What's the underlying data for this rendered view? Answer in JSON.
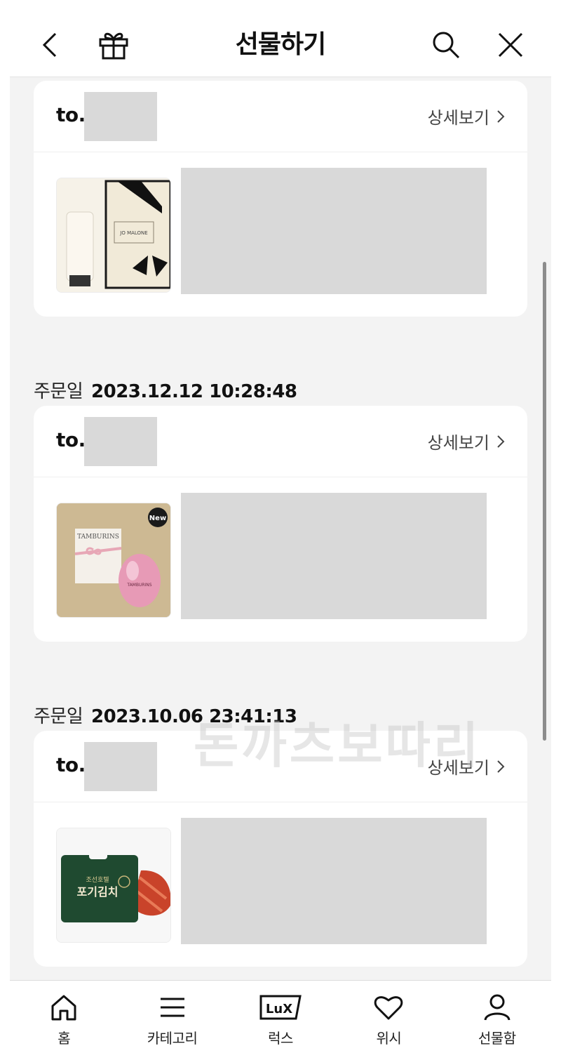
{
  "header": {
    "title": "선물하기",
    "back_icon": "chevron-left-icon",
    "gift_icon": "gift-icon",
    "search_icon": "search-icon",
    "close_icon": "close-icon"
  },
  "orders": [
    {
      "to_label": "to.",
      "detail_label": "상세보기",
      "product": "jo-malone-gift-set"
    },
    {
      "date_label": "주문일",
      "date_value": "2023.12.12  10:28:48",
      "to_label": "to.",
      "detail_label": "상세보기",
      "product": "tamburins-perfume-egg",
      "badge": "New"
    },
    {
      "date_label": "주문일",
      "date_value": "2023.10.06  23:41:13",
      "to_label": "to.",
      "detail_label": "상세보기",
      "product": "pogi-kimchi-pack"
    }
  ],
  "product_text": {
    "jo_malone_box": "JO MALONE",
    "tamburins_box": "TAMBURINS",
    "tamburins_egg": "TAMBURINS",
    "kimchi_title": "포기김치",
    "kimchi_sub": "조선호텔"
  },
  "watermark": "돈까츠보따리",
  "bottom_nav": [
    {
      "label": "홈",
      "icon": "home-icon"
    },
    {
      "label": "카테고리",
      "icon": "menu-icon"
    },
    {
      "label": "럭스",
      "icon": "lux-icon"
    },
    {
      "label": "위시",
      "icon": "heart-icon"
    },
    {
      "label": "선물함",
      "icon": "user-icon"
    }
  ],
  "colors": {
    "background": "#f3f3f3",
    "card": "#ffffff",
    "redaction": "#d9d9d9",
    "text": "#111111"
  }
}
